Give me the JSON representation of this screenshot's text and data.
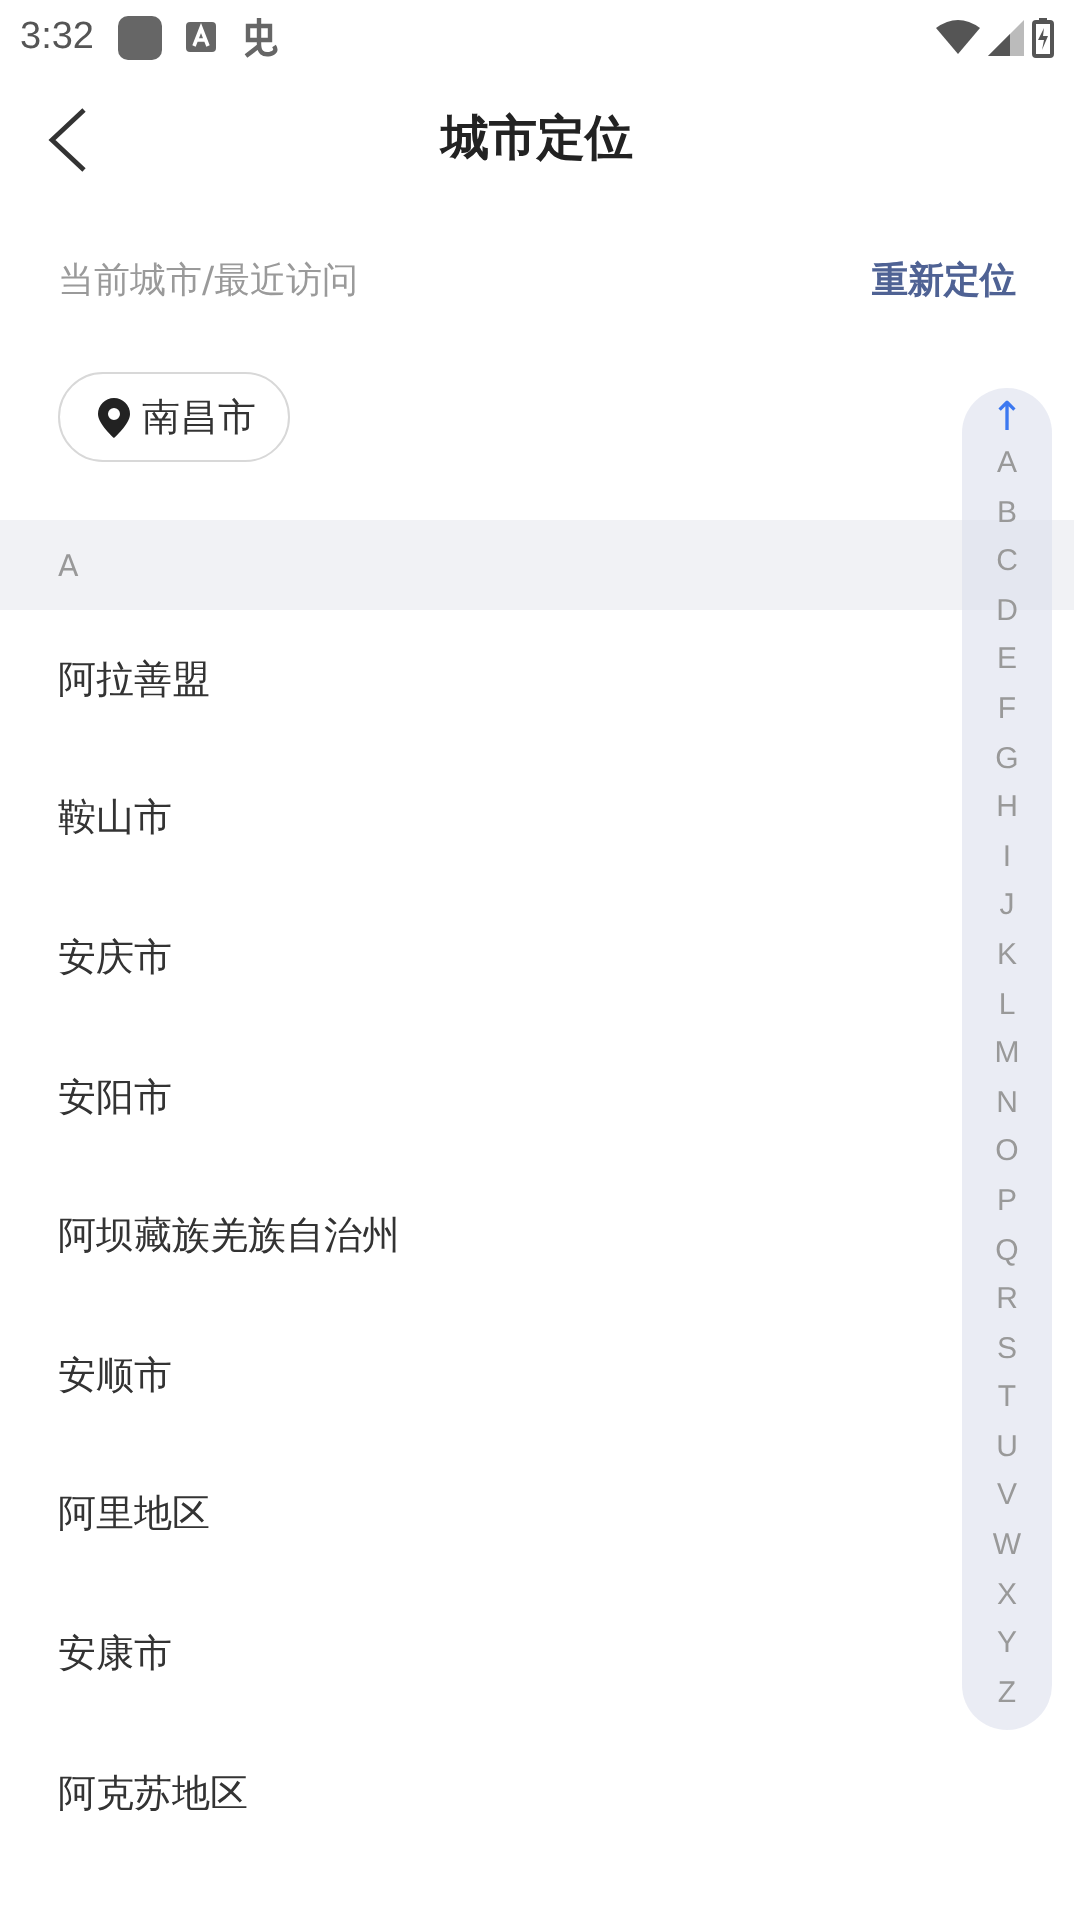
{
  "status_bar": {
    "time": "3:32"
  },
  "header": {
    "title": "城市定位"
  },
  "recent": {
    "label": "当前城市/最近访问",
    "relocate": "重新定位",
    "cities": [
      "南昌市"
    ]
  },
  "sections": [
    {
      "letter": "A",
      "cities": [
        "阿拉善盟",
        "鞍山市",
        "安庆市",
        "安阳市",
        "阿坝藏族羌族自治州",
        "安顺市",
        "阿里地区",
        "安康市",
        "阿克苏地区"
      ]
    }
  ],
  "index_bar": {
    "top": "↑",
    "letters": [
      "A",
      "B",
      "C",
      "D",
      "E",
      "F",
      "G",
      "H",
      "I",
      "J",
      "K",
      "L",
      "M",
      "N",
      "O",
      "P",
      "Q",
      "R",
      "S",
      "T",
      "U",
      "V",
      "W",
      "X",
      "Y",
      "Z"
    ]
  }
}
